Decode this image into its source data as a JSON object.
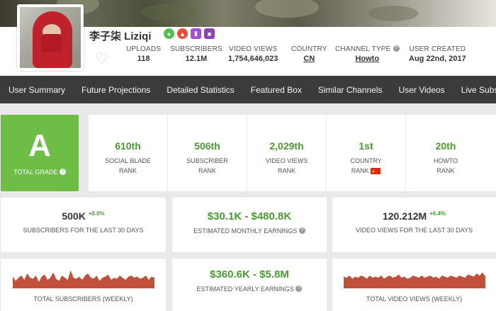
{
  "channel": {
    "name": "李子柒 Liziqi",
    "badges": [
      "eye-icon",
      "fire-icon",
      "chart-icon",
      "video-icon"
    ]
  },
  "header_stats": [
    {
      "label": "UPLOADS",
      "value": "118"
    },
    {
      "label": "SUBSCRIBERS",
      "value": "12.1M"
    },
    {
      "label": "VIDEO VIEWS",
      "value": "1,754,646,023"
    },
    {
      "label": "COUNTRY",
      "value": "CN"
    },
    {
      "label": "CHANNEL TYPE",
      "value": "Howto"
    },
    {
      "label": "USER CREATED",
      "value": "Aug 22nd, 2017"
    }
  ],
  "nav": [
    "User Summary",
    "Future Projections",
    "Detailed Statistics",
    "Featured Box",
    "Similar Channels",
    "User Videos",
    "Live Subscriber Count"
  ],
  "grade": {
    "letter": "A",
    "label": "TOTAL GRADE"
  },
  "ranks": [
    {
      "value": "610th",
      "line1": "SOCIAL BLADE",
      "line2": "RANK"
    },
    {
      "value": "506th",
      "line1": "SUBSCRIBER",
      "line2": "RANK"
    },
    {
      "value": "2,029th",
      "line1": "VIDEO VIEWS",
      "line2": "RANK"
    },
    {
      "value": "1st",
      "line1": "COUNTRY",
      "line2": "RANK"
    },
    {
      "value": "20th",
      "line1": "HOWTO",
      "line2": "RANK"
    }
  ],
  "cards": {
    "subs30": {
      "value": "500K",
      "delta": "+0.0%",
      "label": "SUBSCRIBERS FOR THE LAST 30 DAYS"
    },
    "monthly": {
      "value": "$30.1K - $480.8K",
      "label": "ESTIMATED MONTHLY EARNINGS"
    },
    "views30": {
      "value": "120.212M",
      "delta": "+6.4%",
      "label": "VIDEO VIEWS FOR THE LAST 30 DAYS"
    },
    "total_subs": {
      "label": "TOTAL SUBSCRIBERS (WEEKLY)"
    },
    "yearly": {
      "value": "$360.6K - $5.8M",
      "label": "ESTIMATED YEARLY EARNINGS"
    },
    "total_views": {
      "label": "TOTAL VIDEO VIEWS (WEEKLY)"
    }
  },
  "colors": {
    "accent_green": "#4a9a32",
    "grade_bg": "#6dbd46",
    "nav_bg": "#3b3b3b",
    "sparkline": "#c0503a"
  },
  "sparklines": {
    "subs": [
      0.55,
      0.35,
      0.5,
      0.6,
      0.4,
      0.7,
      0.5,
      0.45,
      0.6,
      0.3,
      0.55,
      0.65,
      0.4,
      0.5,
      0.75,
      0.45,
      0.35,
      0.6,
      0.5,
      0.4,
      0.85,
      0.5,
      0.45,
      0.55,
      0.4,
      0.6,
      0.7,
      0.5,
      0.45,
      0.6,
      0.35,
      0.5,
      0.55,
      0.65,
      0.4,
      0.5,
      0.45,
      0.6,
      0.5,
      0.4,
      0.55,
      0.6,
      0.5,
      0.55,
      0.45,
      0.5,
      0.6,
      0.4,
      0.55,
      0.5
    ],
    "views": [
      0.55,
      0.5,
      0.6,
      0.45,
      0.55,
      0.5,
      0.6,
      0.55,
      0.45,
      0.6,
      0.5,
      0.55,
      0.5,
      0.6,
      0.45,
      0.55,
      0.6,
      0.5,
      0.55,
      0.65,
      0.5,
      0.55,
      0.45,
      0.5,
      0.6,
      0.55,
      0.5,
      0.6,
      0.5,
      0.55,
      0.6,
      0.5,
      0.55,
      0.45,
      0.6,
      0.55,
      0.5,
      0.6,
      0.55,
      0.5,
      0.6,
      0.55,
      0.5,
      0.65,
      0.6,
      0.55,
      0.7,
      0.6,
      0.75,
      0.55
    ]
  }
}
